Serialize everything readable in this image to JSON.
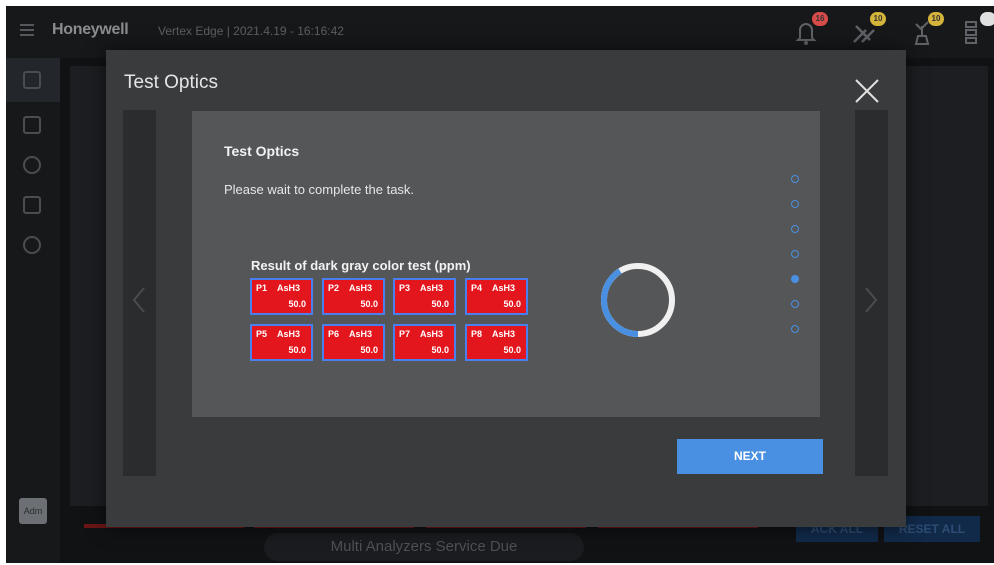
{
  "app": {
    "brand": "Honeywell",
    "system_info": "Vertex Edge | 2021.4.19 - 16:16:42",
    "notifications": [
      {
        "icon": "bell-icon",
        "badge": "16",
        "badge_color": "#d84b4b"
      },
      {
        "icon": "wrench-icon",
        "badge": "10",
        "badge_color": "#d4b43a"
      },
      {
        "icon": "plant-icon",
        "badge": "10",
        "badge_color": "#d4b43a"
      },
      {
        "icon": "list-settings-icon",
        "badge": "",
        "badge_color": "#e0e0e0"
      }
    ],
    "user": "Adm"
  },
  "background": {
    "service_banner": "Multi Analyzers Service Due",
    "ack_all": "ACK ALL",
    "reset_all": "RESET ALL"
  },
  "modal": {
    "title": "Test Optics",
    "content_title": "Test Optics",
    "message": "Please wait to complete the task.",
    "result_title": "Result of dark gray color test (ppm)",
    "results": [
      {
        "port": "P1",
        "gas": "AsH3",
        "value": "50.0"
      },
      {
        "port": "P2",
        "gas": "AsH3",
        "value": "50.0"
      },
      {
        "port": "P3",
        "gas": "AsH3",
        "value": "50.0"
      },
      {
        "port": "P4",
        "gas": "AsH3",
        "value": "50.0"
      },
      {
        "port": "P5",
        "gas": "AsH3",
        "value": "50.0"
      },
      {
        "port": "P6",
        "gas": "AsH3",
        "value": "50.0"
      },
      {
        "port": "P7",
        "gas": "AsH3",
        "value": "50.0"
      },
      {
        "port": "P8",
        "gas": "AsH3",
        "value": "50.0"
      }
    ],
    "result_cell_color": "#e4161d",
    "progress_step_count": 7,
    "progress_active_step": 5,
    "next_label": "NEXT",
    "accent_color": "#4a90e2"
  }
}
